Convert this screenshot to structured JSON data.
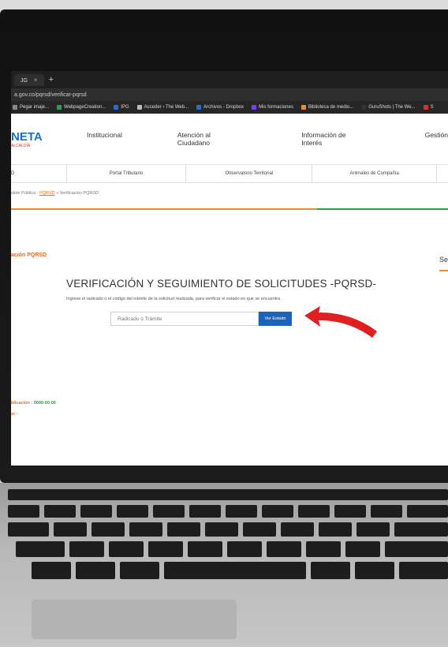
{
  "browser": {
    "tab_label": "JG",
    "tab_close": "×",
    "new_tab": "+",
    "url": "a.gov.co/pqrsd/verificar-pqrsd",
    "bookmarks": [
      {
        "label": "Pegar imaje...",
        "color": "#888888"
      },
      {
        "label": "WebpageCreation...",
        "color": "#2aa14a"
      },
      {
        "label": "IPG",
        "color": "#2b6bd6"
      },
      {
        "label": "Acceder › The Web...",
        "color": "#bbbbbb"
      },
      {
        "label": "Archivos - Dropbox",
        "color": "#2b6bd6"
      },
      {
        "label": "Mis formaciones",
        "color": "#7a3cff"
      },
      {
        "label": "Biblioteca de medio...",
        "color": "#f28a2c"
      },
      {
        "label": "GuruShots | The We...",
        "color": "#333333"
      },
      {
        "label": "S",
        "color": "#d33333"
      }
    ]
  },
  "site": {
    "logo": "NETA",
    "logo_sub": "ALCALDÍA",
    "nav": [
      "Institucional",
      "Atención al Ciudadano",
      "Información de Interés",
      "Gestión"
    ],
    "subnav": [
      "D",
      "Portal Tributario",
      "Observatorio Territorial",
      "Animales de Compañía",
      ""
    ],
    "breadcrumb_prefix": "stión Pública - ",
    "breadcrumb_link": "PQRSD",
    "breadcrumb_suffix": " » Verificación PQRSD"
  },
  "page": {
    "section_title": "ación PQRSD",
    "title": "VERIFICACIÓN Y SEGUIMIENTO DE SOLICITUDES -PQRSD-",
    "description": "Ingrese el radicado o el código del trámite de la solicitud realizada, para verificar el estado en que se encuentra",
    "search_placeholder": "Radicado o Trámite",
    "search_button": "Ver Estado",
    "pub_label": "blicación : ",
    "pub_value": "0000-00-00",
    "author_label": "or :",
    "right_title": "Se"
  },
  "colors": {
    "accent_orange": "#e86c1f",
    "accent_green": "#2aa14a",
    "button_blue": "#1a63b8",
    "arrow_red": "#e02020"
  }
}
